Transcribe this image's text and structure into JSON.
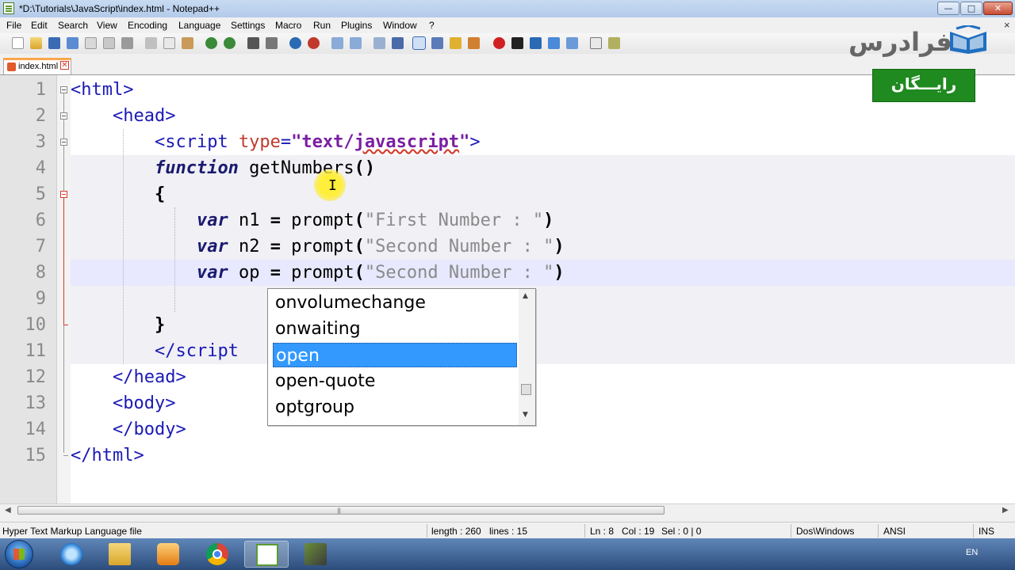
{
  "window": {
    "title": "*D:\\Tutorials\\JavaScript\\index.html - Notepad++",
    "minimize": "—",
    "maximize": "□",
    "close": "✕"
  },
  "menu": {
    "items": [
      "File",
      "Edit",
      "Search",
      "View",
      "Encoding",
      "Language",
      "Settings",
      "Macro",
      "Run",
      "Plugins",
      "Window",
      "?"
    ],
    "close_doc": "×"
  },
  "tab": {
    "label": "index.html",
    "close": "✕"
  },
  "editor": {
    "line_numbers": [
      "1",
      "2",
      "3",
      "4",
      "5",
      "6",
      "7",
      "8",
      "9",
      "10",
      "11",
      "12",
      "13",
      "14",
      "15"
    ],
    "line1": {
      "open": "<html>"
    },
    "line2": {
      "indent": "    ",
      "open": "<head>"
    },
    "line3": {
      "indent": "        ",
      "lt": "<script ",
      "attr": "type",
      "eq": "=",
      "q1": "\"",
      "val_a": "text/",
      "val_b": "javascript",
      "q2": "\"",
      "gt": ">"
    },
    "line4": {
      "indent": "        ",
      "kw": "function",
      "name": " getNumbers",
      "paren": "()"
    },
    "line5": {
      "indent": "        ",
      "brace": "{"
    },
    "line6": {
      "indent": "            ",
      "kw": "var",
      "sp": " n1 ",
      "eq": "=",
      "fn": " prompt",
      "p1": "(",
      "s": "\"First Number : \"",
      "p2": ")"
    },
    "line7": {
      "indent": "            ",
      "kw": "var",
      "sp": " n2 ",
      "eq": "=",
      "fn": " prompt",
      "p1": "(",
      "s": "\"Second Number : \"",
      "p2": ")"
    },
    "line8": {
      "indent": "            ",
      "kw": "var",
      "sp": " op ",
      "eq": "=",
      "fn": " prompt",
      "p1": "(",
      "s": "\"Second Number : \"",
      "p2": ")"
    },
    "line10": {
      "indent": "        ",
      "brace": "}"
    },
    "line11": {
      "indent": "        ",
      "close": "</script"
    },
    "line12": {
      "indent": "    ",
      "close": "</head>"
    },
    "line13": {
      "indent": "    ",
      "open": "<body>"
    },
    "line14": {
      "indent": "    ",
      "close": "</body>"
    },
    "line15": {
      "close": "</html>"
    }
  },
  "autocomplete": {
    "items": [
      "onvolumechange",
      "onwaiting",
      "open",
      "open-quote",
      "optgroup"
    ],
    "selected_index": 2,
    "up": "▲",
    "down": "▼"
  },
  "statusbar": {
    "file_type": "Hyper Text Markup Language file",
    "length": "length : 260",
    "lines": "lines : 15",
    "ln": "Ln : 8",
    "col": "Col : 19",
    "sel": "Sel : 0 | 0",
    "eol": "Dos\\Windows",
    "encoding": "ANSI",
    "mode": "INS"
  },
  "taskbar": {
    "lang": "EN"
  },
  "watermark": {
    "logo": "فرادرس",
    "badge": "رایـــگان"
  },
  "hscroll": {
    "left": "◀",
    "right": "▶",
    "grip": "|||"
  },
  "cursor": {
    "ibeam": "I"
  }
}
